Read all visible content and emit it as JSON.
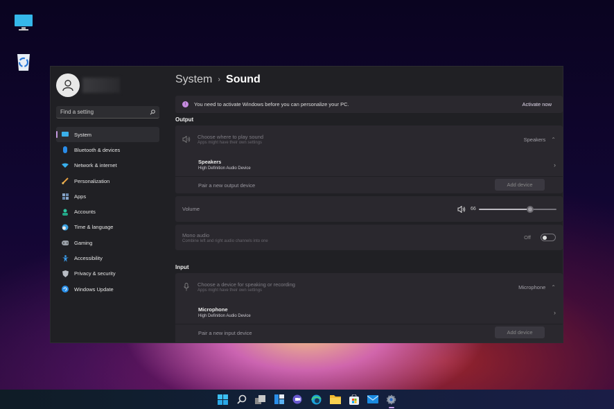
{
  "desktop": {
    "icons": [
      {
        "name": "This PC",
        "icon": "monitor-icon"
      },
      {
        "name": "Recycle Bin",
        "icon": "recycle-bin-icon"
      }
    ]
  },
  "sidebar": {
    "search_placeholder": "Find a setting",
    "items": [
      {
        "label": "System",
        "icon": "system-icon",
        "active": true
      },
      {
        "label": "Bluetooth & devices",
        "icon": "bluetooth-icon"
      },
      {
        "label": "Network & internet",
        "icon": "wifi-icon"
      },
      {
        "label": "Personalization",
        "icon": "brush-icon"
      },
      {
        "label": "Apps",
        "icon": "apps-icon"
      },
      {
        "label": "Accounts",
        "icon": "accounts-icon"
      },
      {
        "label": "Time & language",
        "icon": "globe-clock-icon"
      },
      {
        "label": "Gaming",
        "icon": "gamepad-icon"
      },
      {
        "label": "Accessibility",
        "icon": "accessibility-icon"
      },
      {
        "label": "Privacy & security",
        "icon": "shield-icon"
      },
      {
        "label": "Windows Update",
        "icon": "update-icon"
      }
    ]
  },
  "breadcrumb": {
    "parent": "System",
    "separator": "›",
    "current": "Sound"
  },
  "banner": {
    "message": "You need to activate Windows before you can personalize your PC.",
    "action": "Activate now",
    "accent": "#c68be0"
  },
  "output": {
    "heading": "Output",
    "choose_title": "Choose where to play sound",
    "choose_sub": "Apps might have their own settings",
    "selected": "Speakers",
    "device_name": "Speakers",
    "device_desc": "High Definition Audio Device",
    "pair_label": "Pair a new output device",
    "add_button": "Add device"
  },
  "volume": {
    "label": "Volume",
    "value": "66",
    "level_percent": 66
  },
  "mono": {
    "title": "Mono audio",
    "sub": "Combine left and right audio channels into one",
    "state": "Off"
  },
  "input": {
    "heading": "Input",
    "choose_title": "Choose a device for speaking or recording",
    "choose_sub": "Apps might have their own settings",
    "selected": "Microphone",
    "device_name": "Microphone",
    "device_desc": "High Definition Audio Device",
    "pair_label": "Pair a new input device",
    "add_button": "Add device"
  },
  "taskbar": {
    "items": [
      {
        "name": "Start",
        "icon": "windows-start-icon"
      },
      {
        "name": "Search",
        "icon": "search-icon"
      },
      {
        "name": "Task View",
        "icon": "task-view-icon"
      },
      {
        "name": "Widgets",
        "icon": "widgets-icon"
      },
      {
        "name": "Teams Chat",
        "icon": "chat-icon"
      },
      {
        "name": "Edge",
        "icon": "edge-icon"
      },
      {
        "name": "File Explorer",
        "icon": "folder-icon"
      },
      {
        "name": "Store",
        "icon": "store-icon"
      },
      {
        "name": "Mail",
        "icon": "mail-icon"
      },
      {
        "name": "Settings",
        "icon": "settings-icon",
        "active": true
      }
    ]
  }
}
